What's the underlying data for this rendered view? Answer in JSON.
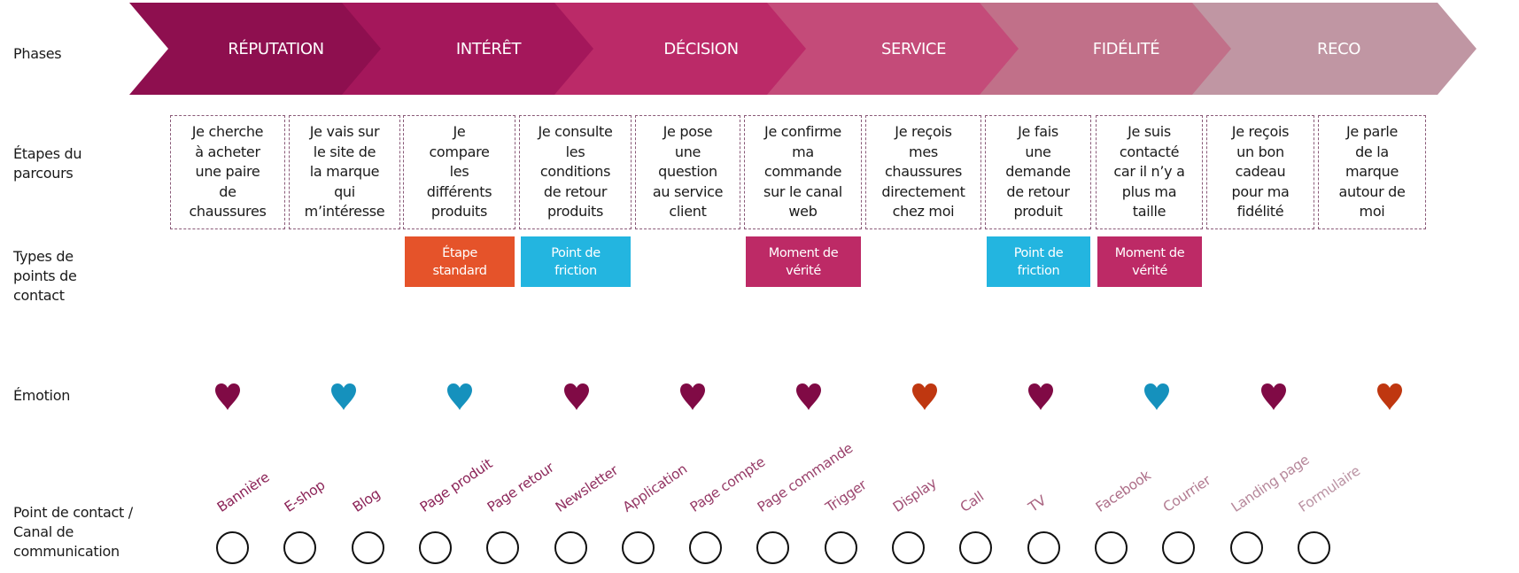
{
  "row_labels": {
    "phases": "Phases",
    "steps": "Étapes du\nparcours",
    "types": "Types de\npoints de\ncontact",
    "emotion": "Émotion",
    "channels": "Point de contact /\nCanal de\ncommunication"
  },
  "phases": [
    {
      "label": "RÉPUTATION",
      "color": "#8e0f4f"
    },
    {
      "label": "INTÉRÊT",
      "color": "#a4175b"
    },
    {
      "label": "DÉCISION",
      "color": "#bb2a68"
    },
    {
      "label": "SERVICE",
      "color": "#c44b79"
    },
    {
      "label": "FIDÉLITÉ",
      "color": "#c17089"
    },
    {
      "label": "RECO",
      "color": "#c096a3"
    }
  ],
  "steps": [
    {
      "text": "Je cherche à acheter une paire de chaussures"
    },
    {
      "text": "Je vais sur le site de la marque qui m’intéresse"
    },
    {
      "text": "Je compare les différents produits"
    },
    {
      "text": "Je consulte les conditions de retour produits"
    },
    {
      "text": "Je pose une question au service client"
    },
    {
      "text": "Je confirme ma commande sur le canal web"
    },
    {
      "text": "Je reçois mes chaussures directement chez moi"
    },
    {
      "text": "Je fais une demande de retour produit"
    },
    {
      "text": "Je suis contacté car il n’y a plus ma taille"
    },
    {
      "text": "Je reçois un bon cadeau pour ma fidélité"
    },
    {
      "text": "Je parle de la marque autour de moi"
    }
  ],
  "step_lines": [
    [
      "Je cherche",
      "à acheter",
      "une paire",
      "de",
      "chaussures"
    ],
    [
      "Je vais sur",
      "le site de",
      "la marque",
      "qui",
      "m’intéresse"
    ],
    [
      "Je",
      "compare",
      "les",
      "différents",
      "produits"
    ],
    [
      "Je consulte",
      "les",
      "conditions",
      "de retour",
      "produits"
    ],
    [
      "Je pose",
      "une",
      "question",
      "au service",
      "client"
    ],
    [
      "Je confirme",
      "ma",
      "commande",
      "sur le canal",
      "web"
    ],
    [
      "Je reçois",
      "mes",
      "chaussures",
      "directement",
      "chez moi"
    ],
    [
      "Je fais",
      "une",
      "demande",
      "de retour",
      "produit"
    ],
    [
      "Je suis",
      "contacté",
      "car il n’y a",
      "plus ma",
      "taille"
    ],
    [
      "Je reçois",
      "un bon",
      "cadeau",
      "pour ma",
      "fidélité"
    ],
    [
      "Je parle",
      "de la",
      "marque",
      "autour de",
      "moi"
    ]
  ],
  "touchpoint_types": [
    {
      "step_index": 2,
      "label": "Étape\nstandard",
      "type": "standard",
      "color": "#e5532a"
    },
    {
      "step_index": 3,
      "label": "Point de\nfriction",
      "type": "friction",
      "color": "#23b5e0"
    },
    {
      "step_index": 5,
      "label": "Moment de\nvérité",
      "type": "truth",
      "color": "#bd2a66"
    },
    {
      "step_index": 7,
      "label": "Point de\nfriction",
      "type": "friction",
      "color": "#23b5e0"
    },
    {
      "step_index": 8,
      "label": "Moment de\nvérité",
      "type": "truth",
      "color": "#bd2a66"
    }
  ],
  "emotions": [
    {
      "icon": "heart-icon",
      "color": "#800a45"
    },
    {
      "icon": "heart-icon",
      "color": "#1591bd"
    },
    {
      "icon": "heart-icon",
      "color": "#1591bd"
    },
    {
      "icon": "heart-icon",
      "color": "#800a45"
    },
    {
      "icon": "heart-icon",
      "color": "#800a45"
    },
    {
      "icon": "heart-icon",
      "color": "#800a45"
    },
    {
      "icon": "heart-icon",
      "color": "#bf3710"
    },
    {
      "icon": "heart-icon",
      "color": "#800a45"
    },
    {
      "icon": "heart-icon",
      "color": "#1591bd"
    },
    {
      "icon": "heart-icon",
      "color": "#800a45"
    },
    {
      "icon": "heart-icon",
      "color": "#bf3710"
    }
  ],
  "channels": [
    {
      "label": "Bannière",
      "color": "#8c2458"
    },
    {
      "label": "E-shop",
      "color": "#8c2458"
    },
    {
      "label": "Blog",
      "color": "#8c2458"
    },
    {
      "label": "Page produit",
      "color": "#8c2458"
    },
    {
      "label": "Page retour",
      "color": "#8e2a5c"
    },
    {
      "label": "Newsletter",
      "color": "#913060"
    },
    {
      "label": "Application",
      "color": "#943664"
    },
    {
      "label": "Page compte",
      "color": "#973c68"
    },
    {
      "label": "Page commande",
      "color": "#9a426c"
    },
    {
      "label": "Trigger",
      "color": "#9d4870"
    },
    {
      "label": "Display",
      "color": "#a04e74"
    },
    {
      "label": "Call",
      "color": "#a35478"
    },
    {
      "label": "TV",
      "color": "#a8627f"
    },
    {
      "label": "Facebook",
      "color": "#ad6e88"
    },
    {
      "label": "Courrier",
      "color": "#b27b91"
    },
    {
      "label": "Landing page",
      "color": "#b6879a"
    },
    {
      "label": "Formulaire",
      "color": "#bb94a4"
    }
  ]
}
